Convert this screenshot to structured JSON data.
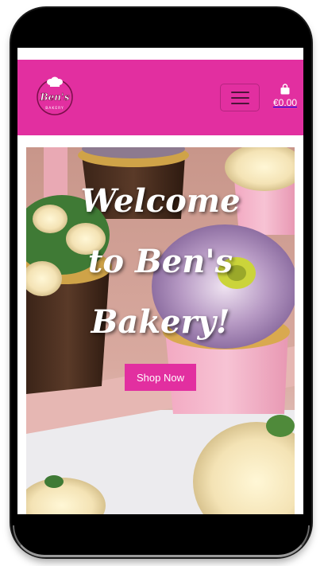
{
  "header": {
    "logo_text": "Ben's",
    "logo_subtext": "BAKERY",
    "cart_total": "€0.00"
  },
  "hero": {
    "title_lines": [
      "Welcome",
      "to Ben's",
      "Bakery!"
    ],
    "button_label": "Shop Now"
  },
  "colors": {
    "brand_pink": "#e22fa0",
    "logo_text": "#c8156b",
    "hamburger_icon": "#4b1439"
  },
  "icons": [
    "logo-icon",
    "hamburger-menu-icon",
    "shopping-bag-icon"
  ]
}
